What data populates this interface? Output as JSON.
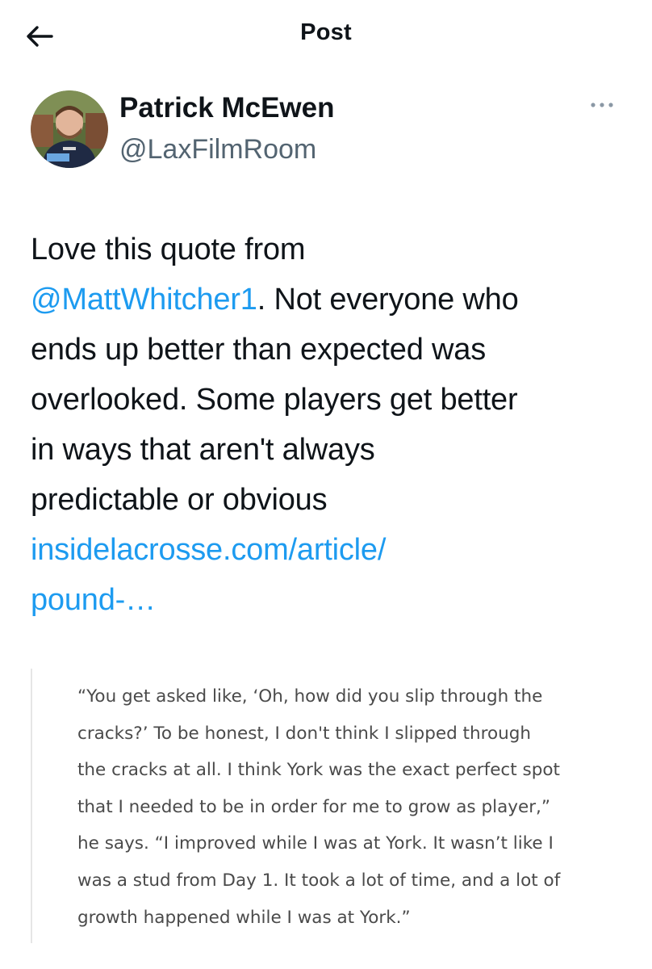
{
  "header": {
    "title": "Post"
  },
  "author": {
    "name": "Patrick McEwen",
    "handle": "@LaxFilmRoom"
  },
  "tweet": {
    "lines": [
      {
        "parts": [
          {
            "text": "Love this quote from",
            "link": false
          }
        ]
      },
      {
        "parts": [
          {
            "text": "@MattWhitcher1",
            "link": true
          },
          {
            "text": ". Not everyone who",
            "link": false
          }
        ]
      },
      {
        "parts": [
          {
            "text": "ends up better than expected was",
            "link": false
          }
        ]
      },
      {
        "parts": [
          {
            "text": "overlooked. Some players get better",
            "link": false
          }
        ]
      },
      {
        "parts": [
          {
            "text": "in ways that aren't always",
            "link": false
          }
        ]
      },
      {
        "parts": [
          {
            "text": "predictable or obvious",
            "link": false
          }
        ]
      },
      {
        "parts": [
          {
            "text": "insidelacrosse.com/article/",
            "link": true
          }
        ]
      },
      {
        "parts": [
          {
            "text": "pound-…",
            "link": true
          }
        ]
      }
    ]
  },
  "quote": {
    "lines": [
      "“You get asked like, ‘Oh, how did you slip through the",
      "cracks?’ To be honest, I don't think I slipped through",
      "the cracks at all. I think York was the exact perfect spot",
      "that I needed to be in order for me to grow as player,”",
      "he says. “I improved while I was at York. It wasn’t like I",
      "was a stud from Day 1. It took a lot of time, and a lot of",
      "growth happened while I was at York.”"
    ]
  },
  "colors": {
    "link": "#1d9bf0",
    "secondary_text": "#536471",
    "quote_text": "#4a4a4a"
  },
  "icons": {
    "back": "arrow-left-icon",
    "more": "more-horizontal-icon"
  }
}
